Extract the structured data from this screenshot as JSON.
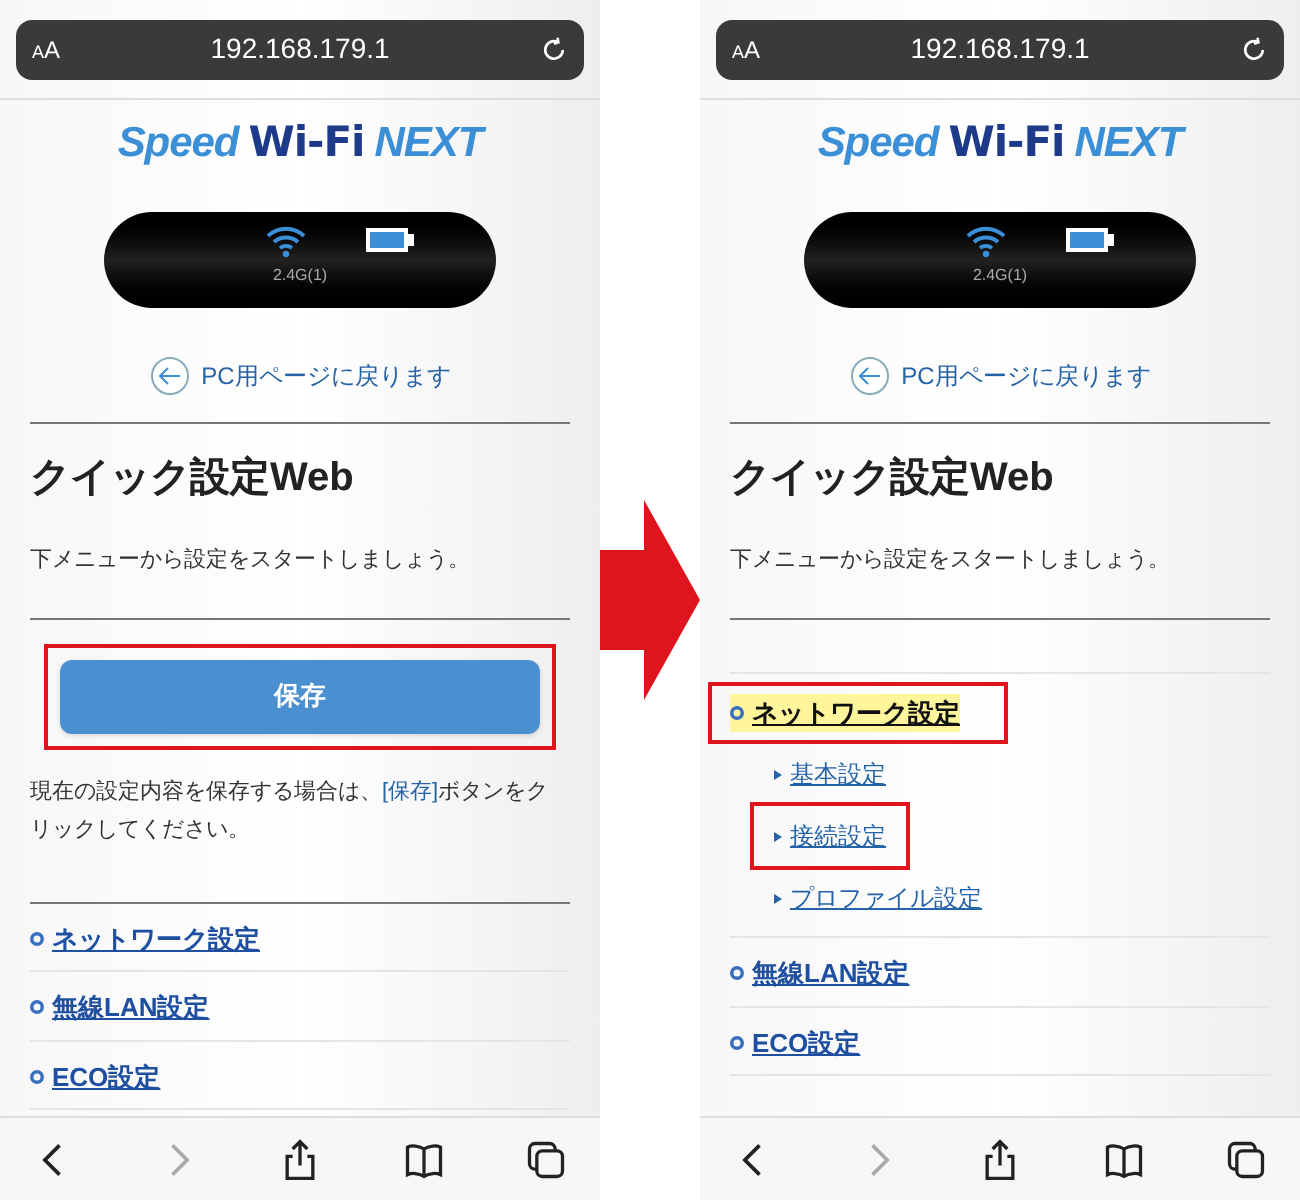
{
  "phones": [
    {
      "url": "192.168.179.1",
      "text_size_label": "AA",
      "logo": [
        "Speed",
        "Wi-Fi",
        "NEXT"
      ],
      "device_band": "2.4G(1)",
      "back_link": "PC用ページに戻ります",
      "title": "クイック設定Web",
      "description": "下メニューから設定をスタートしましょう。",
      "save_button": {
        "label": "保存",
        "callout": true
      },
      "note": [
        {
          "kind": "plain",
          "text": "現在の設定内容を保存する場合は、"
        },
        {
          "kind": "link",
          "text": "[保存]"
        },
        {
          "kind": "plain",
          "text": "ボタンをクリックしてください。"
        }
      ],
      "menu": [
        {
          "label": "ネットワーク設定",
          "selected": false,
          "callout": false
        },
        {
          "label": "無線LAN設定",
          "selected": false,
          "callout": false
        },
        {
          "label": "ECO設定",
          "selected": false,
          "callout": false
        }
      ]
    },
    {
      "url": "192.168.179.1",
      "text_size_label": "AA",
      "logo": [
        "Speed",
        "Wi-Fi",
        "NEXT"
      ],
      "device_band": "2.4G(1)",
      "back_link": "PC用ページに戻ります",
      "title": "クイック設定Web",
      "description": "下メニューから設定をスタートしましょう。",
      "menu": [
        {
          "label": "ネットワーク設定",
          "selected": true,
          "callout": true,
          "children": [
            {
              "label": "基本設定",
              "callout": false
            },
            {
              "label": "接続設定",
              "callout": true
            },
            {
              "label": "プロファイル設定",
              "callout": false
            }
          ]
        },
        {
          "label": "無線LAN設定",
          "selected": false,
          "callout": false
        },
        {
          "label": "ECO設定",
          "selected": false,
          "callout": false
        }
      ]
    }
  ]
}
